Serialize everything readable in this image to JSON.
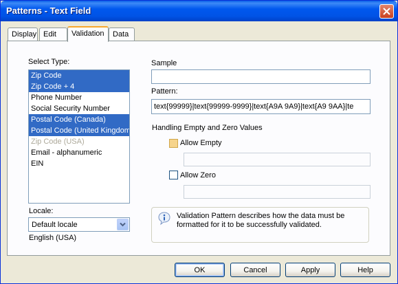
{
  "window": {
    "title": "Patterns - Text Field"
  },
  "tabs": [
    {
      "label": "Display",
      "active": false
    },
    {
      "label": "Edit",
      "active": false
    },
    {
      "label": "Validation",
      "active": true
    },
    {
      "label": "Data",
      "active": false
    }
  ],
  "select_type": {
    "label": "Select Type:",
    "items": [
      {
        "label": "Zip Code",
        "state": "selected"
      },
      {
        "label": "Zip Code + 4",
        "state": "selected"
      },
      {
        "label": "Phone Number",
        "state": "normal"
      },
      {
        "label": "Social Security Number",
        "state": "normal"
      },
      {
        "label": "Postal Code (Canada)",
        "state": "selected"
      },
      {
        "label": "Postal Code (United Kingdom)",
        "state": "selected"
      },
      {
        "label": "Zip Code (USA)",
        "state": "disabled"
      },
      {
        "label": "Email - alphanumeric",
        "state": "normal"
      },
      {
        "label": "EIN",
        "state": "normal"
      }
    ]
  },
  "locale": {
    "label": "Locale:",
    "selected": "Default locale",
    "resolved": "English (USA)"
  },
  "sample": {
    "label": "Sample",
    "value": ""
  },
  "pattern": {
    "label": "Pattern:",
    "value": "text{99999}|text{99999-9999}|text{A9A 9A9}|text{A9 9AA}|te"
  },
  "empty_zero": {
    "heading": "Handling Empty and Zero Values",
    "allow_empty_label": "Allow Empty",
    "allow_empty_checked": false,
    "allow_empty_value": "",
    "allow_zero_label": "Allow Zero",
    "allow_zero_checked": false,
    "allow_zero_value": ""
  },
  "info": {
    "text": "Validation Pattern describes how the data must be formatted for it to be successfully validated."
  },
  "buttons": {
    "ok": "OK",
    "cancel": "Cancel",
    "apply": "Apply",
    "help": "Help"
  },
  "colors": {
    "titlebar": "#0054e3",
    "selection": "#316ac5",
    "tab_highlight": "#f9a72c",
    "dialog_bg": "#ece9d8"
  }
}
